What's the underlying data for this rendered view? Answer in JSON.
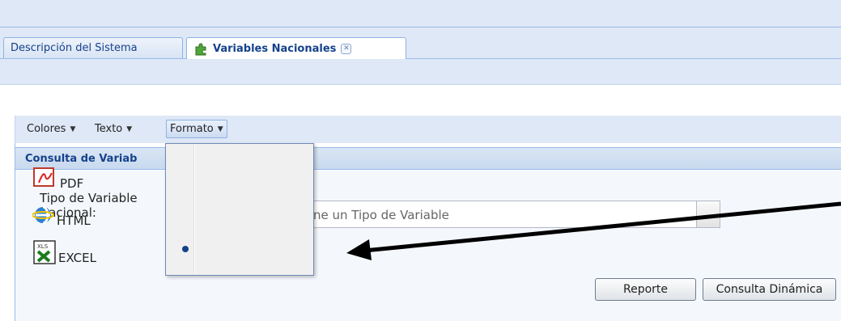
{
  "tabs": [
    {
      "label": "Descripción del Sistema",
      "active": false
    },
    {
      "label": "Variables Nacionales",
      "active": true,
      "icon": "puzzle-icon",
      "closable": true
    }
  ],
  "toolbar": {
    "menus": [
      "Colores",
      "Texto",
      "Formato"
    ],
    "active_menu": "Formato"
  },
  "panel": {
    "title": "Consulta de Variab",
    "field_label": "Tipo de Variable Nacional:",
    "combo_visible_text": "ne un Tipo de Variable"
  },
  "dropdown": {
    "items": [
      {
        "label": "PDF",
        "icon": "pdf-file-icon"
      },
      {
        "label": "HTML",
        "icon": "ie-html-icon"
      },
      {
        "label": "EXCEL",
        "icon": "excel-xls-icon",
        "selected": true
      }
    ]
  },
  "buttons": {
    "reporte": "Reporte",
    "consulta": "Consulta Dinámica"
  },
  "colors": {
    "header_blue": "#15428b",
    "bar_bg": "#dfe8f6",
    "border_blue": "#99bbe8"
  }
}
